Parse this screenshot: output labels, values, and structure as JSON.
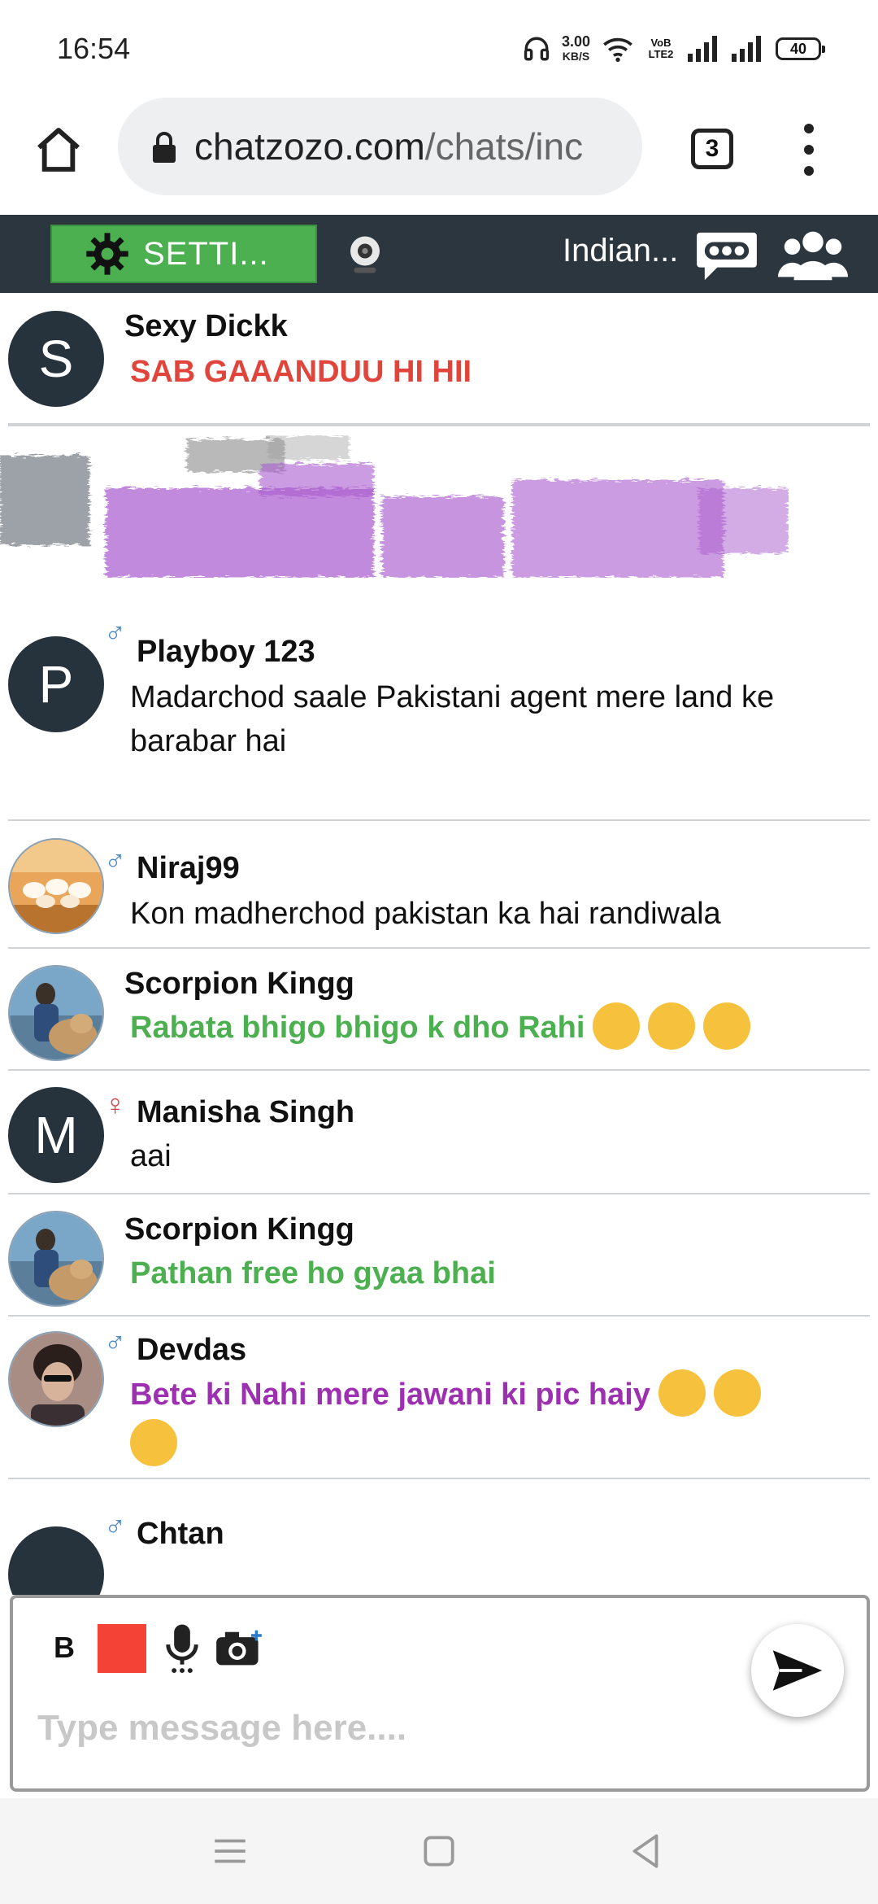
{
  "status_bar": {
    "time": "16:54",
    "net_speed": "3.00",
    "net_unit": "KB/S",
    "volte": "VoB LTE2",
    "battery": "40"
  },
  "browser": {
    "url_host": "chatzozo.com",
    "url_path": "/chats/inc",
    "tab_count": "3"
  },
  "toolbar": {
    "settings_label": "SETTI...",
    "room_name": "Indian..."
  },
  "messages": [
    {
      "name": "Sexy Dickk",
      "avatar_letter": "S",
      "text": "SAB GAAANDUU HI HII",
      "color": "#e0443a",
      "gender": ""
    },
    {
      "name": "Playboy 123",
      "avatar_letter": "P",
      "text": "Madarchod saale Pakistani agent mere land ke barabar hai",
      "color": "#111111",
      "gender": "male"
    },
    {
      "name": "Niraj99",
      "avatar_letter": "",
      "text": "Kon madherchod pakistan ka hai randiwala",
      "color": "#111111",
      "gender": "male"
    },
    {
      "name": "Scorpion Kingg",
      "avatar_letter": "",
      "text": "Rabata bhigo bhigo k dho Rahi",
      "color": "#4caf50",
      "gender": ""
    },
    {
      "name": "Manisha Singh",
      "avatar_letter": "M",
      "text": "aai",
      "color": "#111111",
      "gender": "female"
    },
    {
      "name": "Scorpion Kingg",
      "avatar_letter": "",
      "text": "Pathan free ho gyaa bhai",
      "color": "#4caf50",
      "gender": ""
    },
    {
      "name": "Devdas",
      "avatar_letter": "",
      "text": "Bete ki Nahi mere jawani ki pic haiy",
      "color": "#9c30b0",
      "gender": "male"
    },
    {
      "name": "Chtan",
      "avatar_letter": "",
      "text": "",
      "color": "#111111",
      "gender": "male"
    }
  ],
  "gender_symbols": {
    "male": "♂",
    "female": "♀"
  },
  "composer": {
    "bold_label": "B",
    "placeholder": "Type message here...."
  }
}
